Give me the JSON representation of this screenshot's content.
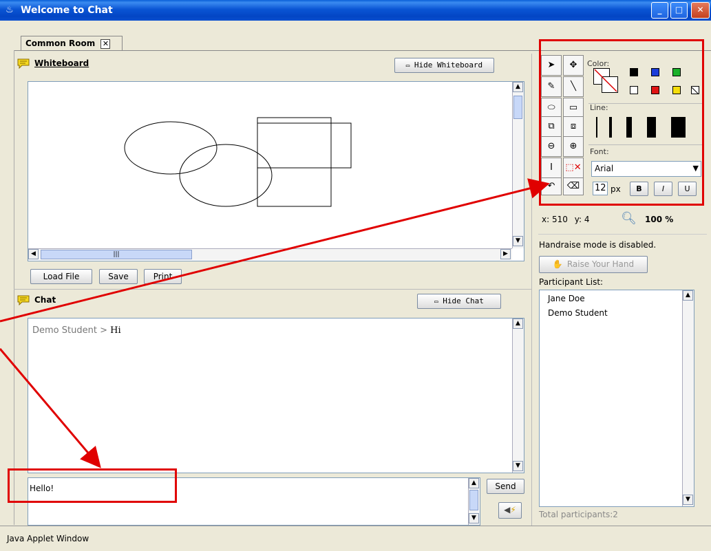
{
  "window": {
    "title": "Welcome to Chat",
    "status": "Java Applet Window"
  },
  "tabs": [
    {
      "label": "Common Room"
    }
  ],
  "whiteboard": {
    "title": "Whiteboard",
    "hide_label": "Hide Whiteboard",
    "load_label": "Load File",
    "save_label": "Save",
    "print_label": "Print"
  },
  "chat": {
    "title": "Chat",
    "hide_label": "Hide Chat",
    "messages": [
      {
        "sender": "Demo Student",
        "separator": ">",
        "text": "Hi"
      }
    ],
    "input_value": "Hello!",
    "send_label": "Send"
  },
  "tools": {
    "color_label": "Color:",
    "line_label": "Line:",
    "font_label": "Font:",
    "font_value": "Arial",
    "size_value": "12",
    "size_unit": "px",
    "bold_label": "B",
    "italic_label": "I",
    "underline_label": "U",
    "palette": [
      "#000000",
      "#1a3cd8",
      "#1bb12a",
      "#ffffff",
      "#e01414",
      "#f5dd0a"
    ]
  },
  "coords": {
    "x_label": "x:",
    "x_value": "510",
    "y_label": "y:",
    "y_value": "4",
    "zoom": "100 %"
  },
  "handraise": {
    "status": "Handraise mode is disabled.",
    "button": "Raise Your Hand"
  },
  "participants": {
    "label": "Participant List:",
    "items": [
      "Jane Doe",
      "Demo Student"
    ],
    "total": "Total participants:2"
  },
  "annotation_color": "#e00000"
}
